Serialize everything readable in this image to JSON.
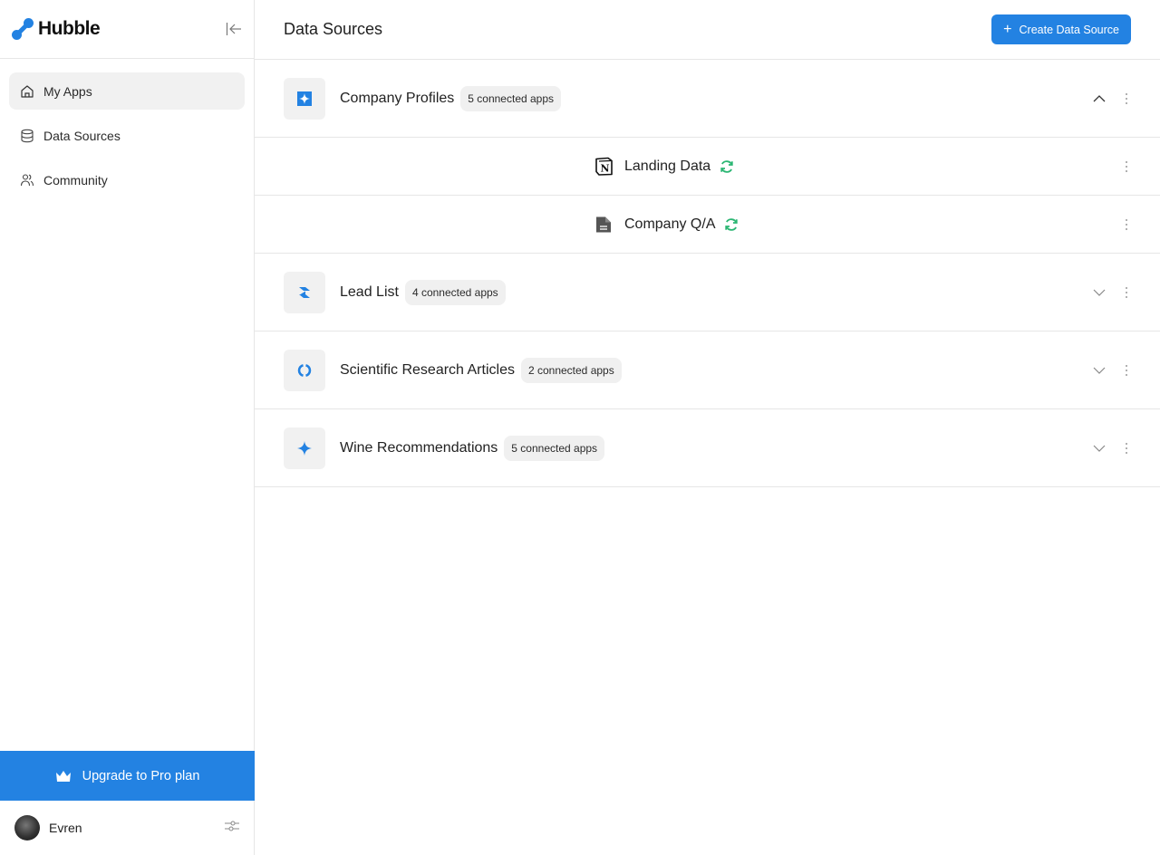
{
  "app": {
    "name": "Hubble",
    "brand_color": "#2382e2"
  },
  "sidebar": {
    "collapse_icon": "collapse-left-icon",
    "items": [
      {
        "label": "My Apps",
        "icon": "home-icon",
        "active": true
      },
      {
        "label": "Data Sources",
        "icon": "database-icon",
        "active": false
      },
      {
        "label": "Community",
        "icon": "users-icon",
        "active": false
      }
    ],
    "upgrade_label": "Upgrade to Pro plan",
    "upgrade_icon": "crown-icon",
    "user": {
      "name": "Evren",
      "settings_icon": "sliders-icon"
    }
  },
  "header": {
    "title": "Data Sources",
    "create_button": "Create Data Source"
  },
  "data_sources": [
    {
      "name": "Company Profiles",
      "badge": "5 connected apps",
      "icon": "sparkle-square-icon",
      "expanded": true,
      "children": [
        {
          "name": "Landing Data",
          "icon": "notion-icon",
          "status_icon": "sync-icon"
        },
        {
          "name": "Company Q/A",
          "icon": "document-icon",
          "status_icon": "sync-icon"
        }
      ]
    },
    {
      "name": "Lead List",
      "badge": "4 connected apps",
      "icon": "zap-icon",
      "expanded": false
    },
    {
      "name": "Scientific Research Articles",
      "badge": "2 connected apps",
      "icon": "ring-icon",
      "expanded": false
    },
    {
      "name": "Wine Recommendations",
      "badge": "5 connected apps",
      "icon": "sparkle-icon",
      "expanded": false
    }
  ],
  "colors": {
    "sync_green": "#2bb673",
    "border": "#e6e6e6",
    "badge_bg": "#f0f0f0"
  }
}
